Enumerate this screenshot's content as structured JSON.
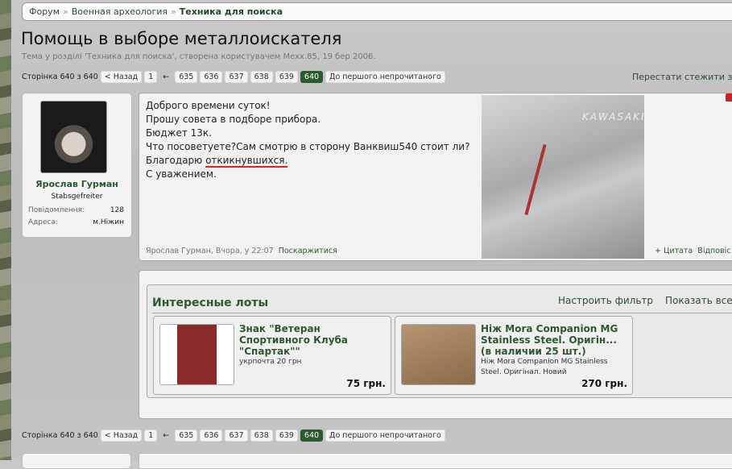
{
  "breadcrumb": [
    "Форум",
    "Военная археология",
    "Техника для поиска"
  ],
  "title": "Помощь в выборе металлоискателя",
  "subtitle": "Тема у розділі 'Техника для поиска', створена користувачем Mexx.85, 19 бер 2006.",
  "pagenav": {
    "label": "Сторінка 640 з 640",
    "prev": "< Назад",
    "first": "1",
    "arrow": "←",
    "pages": [
      "635",
      "636",
      "637",
      "638",
      "639",
      "640"
    ],
    "unread": "До першого непрочитаного"
  },
  "unwatch": "Перестати стежити за те",
  "post": {
    "author": "Ярослав Гурман",
    "rank": "Stabsgefreiter",
    "stats": [
      {
        "k": "Повідомлення:",
        "v": "128"
      },
      {
        "k": "Адреса:",
        "v": "м.Ніжин"
      }
    ],
    "lines": [
      "Доброго времени суток!",
      "Прошу совета в подборе прибора.",
      "Бюджет 13к.",
      "Что посоветуете?Сам смотрю в сторону Ванквиш540 стоит ли?"
    ],
    "line5a": "Благодарю ",
    "line5b": "откикнувшихся.",
    "line6": "С уважением.",
    "meta": "Ярослав Гурман, Вчора, у 22:07",
    "report": "Поскаржитися",
    "quote": "+ Цитата",
    "reply": "Відповіс",
    "image_text": "KAWASAKI"
  },
  "lots": {
    "title": "Интересные лоты",
    "filter": "Настроить фильтр",
    "showall": "Показать все",
    "items": [
      {
        "title": "Знак \"Ветеран Спортивного Клуба \"Спартак\"\"",
        "desc": "укрпочта 20 грн",
        "price": "75 грн."
      },
      {
        "title": "Ніж Mora Companion MG Stainless Steel. Оригін... (в наличии 25 шт.)",
        "desc": "Ніж Mora Companion MG Stainless Steel. Оригінал. Новий",
        "price": "270 грн."
      }
    ]
  }
}
